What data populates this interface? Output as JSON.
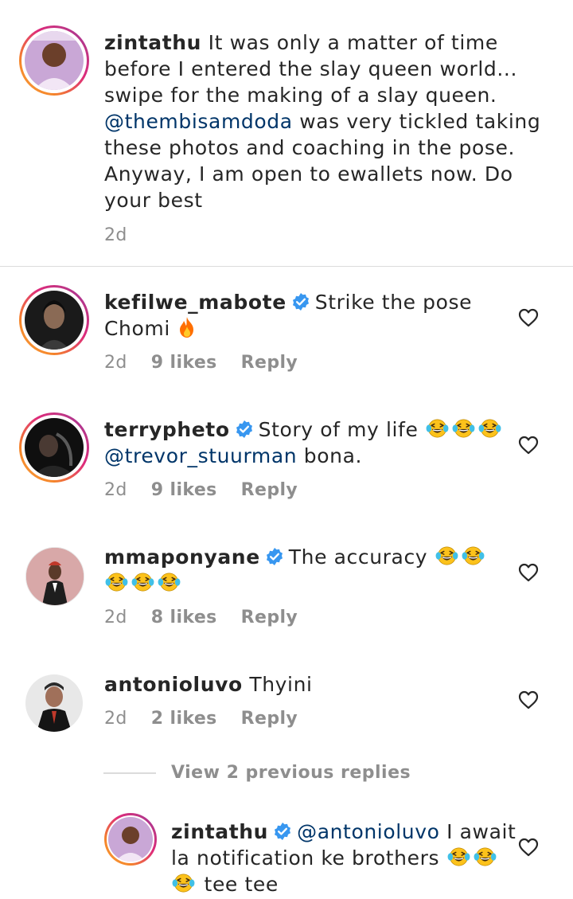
{
  "post": {
    "username": "zintathu",
    "caption_a": " It was only a matter of time\nbefore I entered the slay queen world...\nswipe for the making of a slay queen.\n",
    "mention": "@thembisamdoda",
    "caption_b": " was very tickled taking\nthese photos and coaching in the pose.\nAnyway, I am open to ewallets now. Do\nyour best",
    "time": "2d"
  },
  "comments": [
    {
      "username": "kefilwe_mabote",
      "verified": true,
      "text_a": "Strike the pose\nChomi ",
      "emoji": "fire",
      "time": "2d",
      "likes": "9 likes",
      "reply": "Reply"
    },
    {
      "username": "terrypheto",
      "verified": true,
      "text_a": "Story of my life ",
      "mention": "@trevor_stuurman",
      "text_b": " bona.",
      "time": "2d",
      "likes": "9 likes",
      "reply": "Reply"
    },
    {
      "username": "mmaponyane",
      "verified": true,
      "text_a": "The accuracy ",
      "time": "2d",
      "likes": "8 likes",
      "reply": "Reply"
    },
    {
      "username": "antonioluvo",
      "verified": false,
      "text_a": " Thyini",
      "time": "2d",
      "likes": "2 likes",
      "reply": "Reply"
    }
  ],
  "view_replies": "View 2 previous replies",
  "reply": {
    "username": "zintathu",
    "verified": true,
    "mention": "@antonioluvo",
    "text_a": " I await\nla notification ke brothers ",
    "text_b": " tee tee"
  },
  "colors": {
    "mention": "#003569",
    "muted": "#8e8e8e",
    "verified": "#3897f0",
    "divider": "#dbdbdb"
  }
}
